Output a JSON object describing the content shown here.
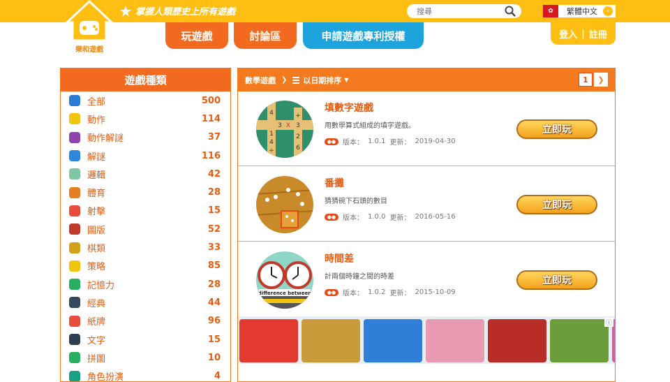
{
  "header": {
    "logo_text": "樂和遊戲",
    "slogan": "掌握人類歷史上所有遊戲",
    "search_placeholder": "搜尋",
    "language": "繁體中文",
    "nav": [
      "玩遊戲",
      "討論區",
      "申請遊戲專利授權"
    ],
    "login": "登入",
    "register": "註冊",
    "auth_sep": "|"
  },
  "sidebar": {
    "title": "遊戲種類",
    "items": [
      {
        "label": "全部",
        "count": "500",
        "icon": "all-icon",
        "color": "#2a7ad6"
      },
      {
        "label": "動作",
        "count": "114",
        "icon": "pacman-icon",
        "color": "#f1c40f"
      },
      {
        "label": "動作解謎",
        "count": "37",
        "icon": "blocks-icon",
        "color": "#8e44ad"
      },
      {
        "label": "解謎",
        "count": "116",
        "icon": "puzzle-icon",
        "color": "#2e86de"
      },
      {
        "label": "邏輯",
        "count": "42",
        "icon": "cube-icon",
        "color": "#7fc6a4"
      },
      {
        "label": "體育",
        "count": "28",
        "icon": "basketball-icon",
        "color": "#e67e22"
      },
      {
        "label": "射擊",
        "count": "15",
        "icon": "target-icon",
        "color": "#e74c3c"
      },
      {
        "label": "圖版",
        "count": "52",
        "icon": "dice-icon",
        "color": "#c0392b"
      },
      {
        "label": "棋類",
        "count": "33",
        "icon": "crown-icon",
        "color": "#d4a017"
      },
      {
        "label": "策略",
        "count": "85",
        "icon": "bulb-icon",
        "color": "#f1c40f"
      },
      {
        "label": "記憶力",
        "count": "28",
        "icon": "brain-icon",
        "color": "#27ae60"
      },
      {
        "label": "經典",
        "count": "44",
        "icon": "invader-icon",
        "color": "#34495e"
      },
      {
        "label": "紙牌",
        "count": "96",
        "icon": "cards-icon",
        "color": "#e74c3c"
      },
      {
        "label": "文字",
        "count": "15",
        "icon": "bb-icon",
        "color": "#2c3e50"
      },
      {
        "label": "拼圖",
        "count": "10",
        "icon": "jigsaw-icon",
        "color": "#27ae60"
      },
      {
        "label": "角色扮演",
        "count": "4",
        "icon": "role-icon",
        "color": "#16a085"
      }
    ]
  },
  "main": {
    "breadcrumb": "數學遊戲",
    "sort": "以日期排序",
    "page": "1",
    "games": [
      {
        "title": "填數字遊戲",
        "desc": "用數學算式組成的填字遊戲。",
        "version_label": "版本：",
        "version": "1.0.1",
        "updated_label": "更新：",
        "updated": "2019-04-30",
        "play": "立即玩"
      },
      {
        "title": "番攤",
        "desc": "猜猜碗下石頭的數目",
        "version_label": "版本：",
        "version": "1.0.0",
        "updated_label": "更新：",
        "updated": "2016-05-16",
        "play": "立即玩"
      },
      {
        "title": "時間差",
        "desc": "計兩個時鐘之間的時差",
        "version_label": "版本：",
        "version": "1.0.2",
        "updated_label": "更新：",
        "updated": "2015-10-09",
        "play": "立即玩"
      }
    ],
    "thumb_text": {
      "crossword": [
        "4",
        "3",
        "X",
        "3",
        "1",
        "+",
        "4",
        "2",
        "÷",
        "6"
      ],
      "clock_caption": "difference between"
    },
    "ad": {
      "badge": "ⓘ",
      "tiles": [
        "#e23a2e",
        "#c89a3a",
        "#2f7fd8",
        "#e89ab0",
        "#b92d28",
        "#6b9e3a",
        "#d85aa0"
      ]
    }
  }
}
